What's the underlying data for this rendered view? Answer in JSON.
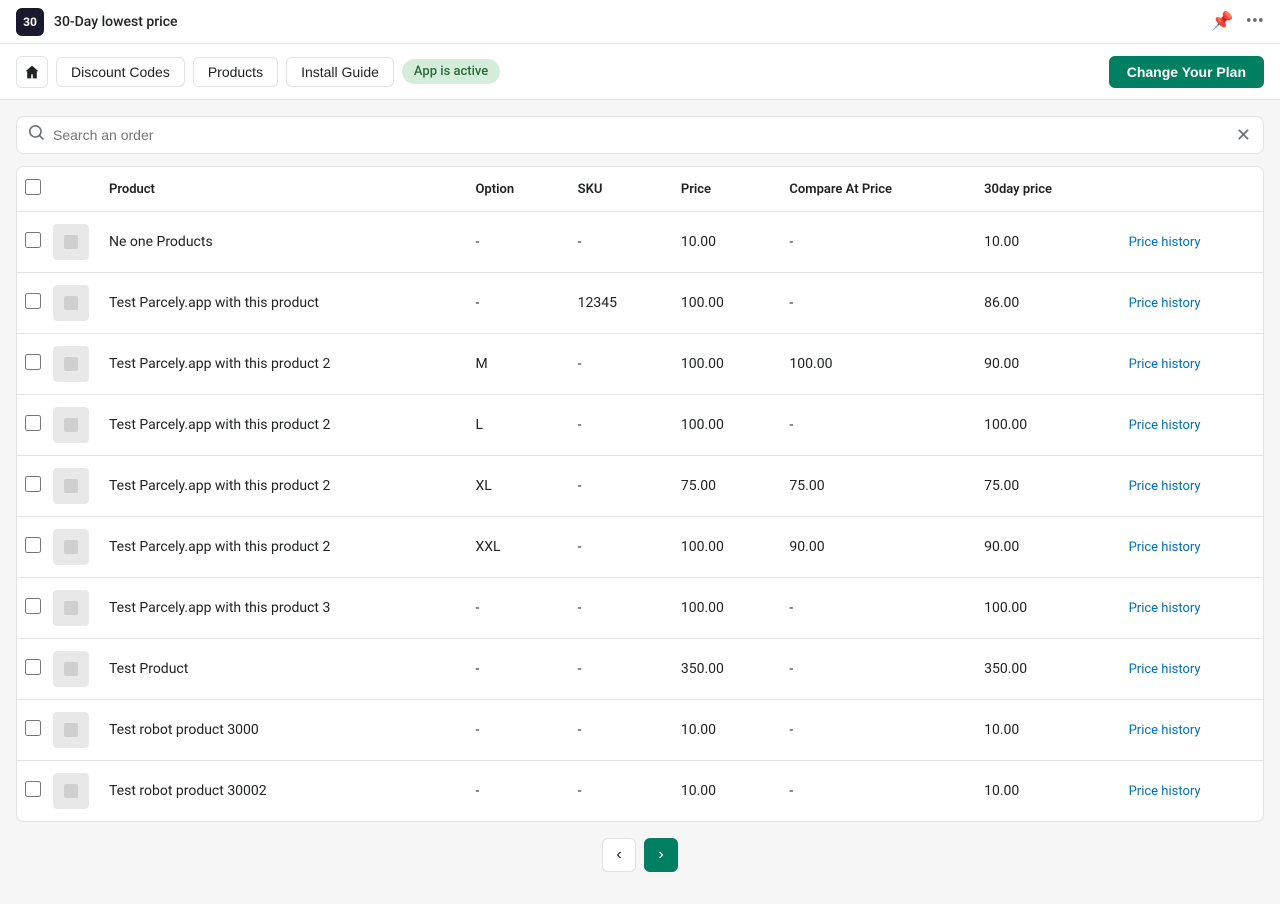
{
  "topBar": {
    "logo": "30",
    "title": "30-Day lowest price",
    "pinIcon": "📌",
    "moreIcon": "⋯"
  },
  "nav": {
    "homeIcon": "🏠",
    "discountCodes": "Discount Codes",
    "products": "Products",
    "installGuide": "Install Guide",
    "appStatus": "App is active",
    "changePlan": "Change Your Plan"
  },
  "search": {
    "placeholder": "Search an order",
    "clearIcon": "✕"
  },
  "table": {
    "columns": [
      "Product",
      "Option",
      "SKU",
      "Price",
      "Compare At Price",
      "30day price",
      ""
    ],
    "rows": [
      {
        "product": "Ne one Products",
        "option": "-",
        "sku": "-",
        "price": "10.00",
        "compareAt": "-",
        "thirtyDay": "10.00"
      },
      {
        "product": "Test Parcely.app with this product",
        "option": "-",
        "sku": "12345",
        "price": "100.00",
        "compareAt": "-",
        "thirtyDay": "86.00"
      },
      {
        "product": "Test Parcely.app with this product 2",
        "option": "M",
        "sku": "-",
        "price": "100.00",
        "compareAt": "100.00",
        "thirtyDay": "90.00"
      },
      {
        "product": "Test Parcely.app with this product 2",
        "option": "L",
        "sku": "-",
        "price": "100.00",
        "compareAt": "-",
        "thirtyDay": "100.00"
      },
      {
        "product": "Test Parcely.app with this product 2",
        "option": "XL",
        "sku": "-",
        "price": "75.00",
        "compareAt": "75.00",
        "thirtyDay": "75.00"
      },
      {
        "product": "Test Parcely.app with this product 2",
        "option": "XXL",
        "sku": "-",
        "price": "100.00",
        "compareAt": "90.00",
        "thirtyDay": "90.00"
      },
      {
        "product": "Test Parcely.app with this product 3",
        "option": "-",
        "sku": "-",
        "price": "100.00",
        "compareAt": "-",
        "thirtyDay": "100.00"
      },
      {
        "product": "Test Product",
        "option": "-",
        "sku": "-",
        "price": "350.00",
        "compareAt": "-",
        "thirtyDay": "350.00"
      },
      {
        "product": "Test robot product 3000",
        "option": "-",
        "sku": "-",
        "price": "10.00",
        "compareAt": "-",
        "thirtyDay": "10.00"
      },
      {
        "product": "Test robot product 30002",
        "option": "-",
        "sku": "-",
        "price": "10.00",
        "compareAt": "-",
        "thirtyDay": "10.00"
      }
    ],
    "priceHistoryLabel": "Price history"
  },
  "pagination": {
    "prevIcon": "‹",
    "nextIcon": "›"
  }
}
